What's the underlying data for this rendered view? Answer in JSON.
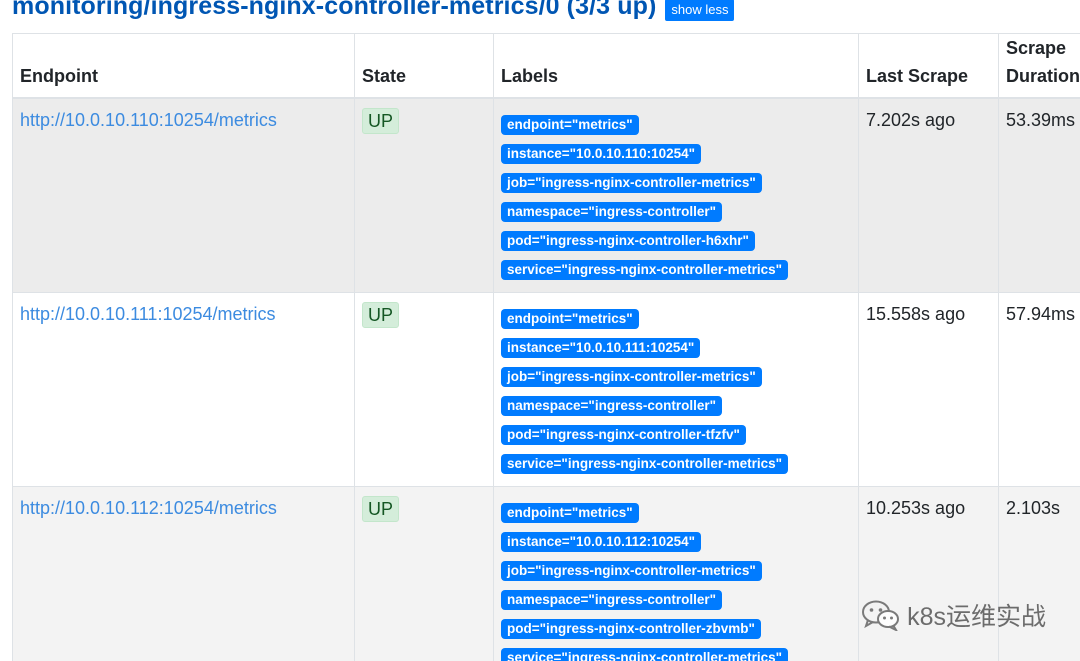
{
  "header": {
    "title": "monitoring/ingress-nginx-controller-metrics/0 (3/3 up)",
    "toggle_label": "show less"
  },
  "table": {
    "columns": [
      "Endpoint",
      "State",
      "Labels",
      "Last Scrape",
      "Scrape Duration"
    ],
    "rows": [
      {
        "endpoint": "http://10.0.10.110:10254/metrics",
        "state": "UP",
        "labels": [
          "endpoint=\"metrics\"",
          "instance=\"10.0.10.110:10254\"",
          "job=\"ingress-nginx-controller-metrics\"",
          "namespace=\"ingress-controller\"",
          "pod=\"ingress-nginx-controller-h6xhr\"",
          "service=\"ingress-nginx-controller-metrics\""
        ],
        "last_scrape": "7.202s ago",
        "scrape_duration": "53.39ms"
      },
      {
        "endpoint": "http://10.0.10.111:10254/metrics",
        "state": "UP",
        "labels": [
          "endpoint=\"metrics\"",
          "instance=\"10.0.10.111:10254\"",
          "job=\"ingress-nginx-controller-metrics\"",
          "namespace=\"ingress-controller\"",
          "pod=\"ingress-nginx-controller-tfzfv\"",
          "service=\"ingress-nginx-controller-metrics\""
        ],
        "last_scrape": "15.558s ago",
        "scrape_duration": "57.94ms"
      },
      {
        "endpoint": "http://10.0.10.112:10254/metrics",
        "state": "UP",
        "labels": [
          "endpoint=\"metrics\"",
          "instance=\"10.0.10.112:10254\"",
          "job=\"ingress-nginx-controller-metrics\"",
          "namespace=\"ingress-controller\"",
          "pod=\"ingress-nginx-controller-zbvmb\"",
          "service=\"ingress-nginx-controller-metrics\""
        ],
        "last_scrape": "10.253s ago",
        "scrape_duration": "2.103s"
      }
    ]
  },
  "watermark": {
    "icon": "wechat-icon",
    "text": "k8s运维实战"
  },
  "colors": {
    "title": "#0056b3",
    "link": "#3c8be0",
    "badge": "#007bff",
    "state_up_bg": "#d4edda",
    "state_up_text": "#155724"
  }
}
